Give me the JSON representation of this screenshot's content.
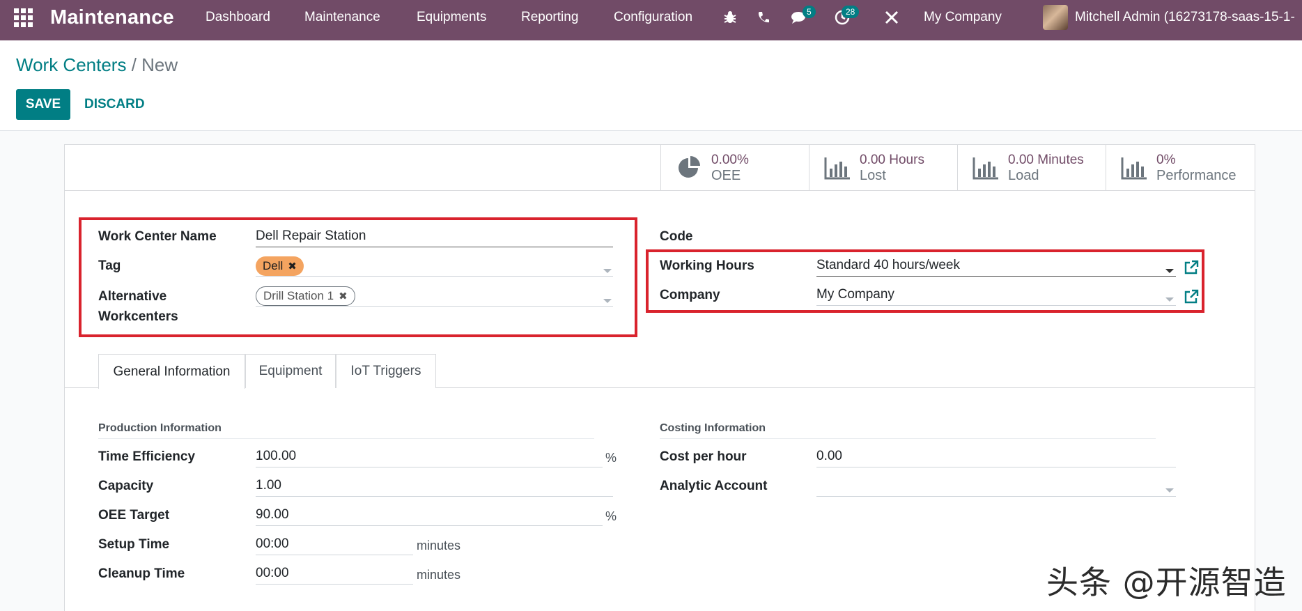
{
  "navbar": {
    "app_name": "Maintenance",
    "menu": [
      "Dashboard",
      "Maintenance",
      "Equipments",
      "Reporting",
      "Configuration"
    ],
    "messages_badge": "5",
    "activities_badge": "28",
    "company": "My Company",
    "user": "Mitchell Admin (16273178-saas-15-1-"
  },
  "breadcrumb": {
    "parent": "Work Centers",
    "separator": "/",
    "current": "New"
  },
  "buttons": {
    "save": "SAVE",
    "discard": "DISCARD"
  },
  "stats": [
    {
      "value": "0.00%",
      "label": "OEE",
      "icon": "pie-chart-icon"
    },
    {
      "value": "0.00 Hours",
      "label": "Lost",
      "icon": "bar-chart-icon"
    },
    {
      "value": "0.00 Minutes",
      "label": "Load",
      "icon": "bar-chart-icon"
    },
    {
      "value": "0%",
      "label": "Performance",
      "icon": "bar-chart-icon"
    }
  ],
  "form": {
    "work_center_name_label": "Work Center Name",
    "work_center_name_value": "Dell Repair Station",
    "tag_label": "Tag",
    "tag_value": "Dell",
    "alt_label_line1": "Alternative",
    "alt_label_line2": "Workcenters",
    "alt_value": "Drill Station 1",
    "code_label": "Code",
    "working_hours_label": "Working Hours",
    "working_hours_value": "Standard 40 hours/week",
    "company_label": "Company",
    "company_value": "My Company"
  },
  "tabs": [
    "General Information",
    "Equipment",
    "IoT Triggers"
  ],
  "production": {
    "title": "Production Information",
    "time_efficiency_label": "Time Efficiency",
    "time_efficiency_value": "100.00",
    "capacity_label": "Capacity",
    "capacity_value": "1.00",
    "oee_target_label": "OEE Target",
    "oee_target_value": "90.00",
    "setup_time_label": "Setup Time",
    "setup_time_value": "00:00",
    "cleanup_time_label": "Cleanup Time",
    "cleanup_time_value": "00:00",
    "percent_unit": "%",
    "minutes_unit": "minutes"
  },
  "costing": {
    "title": "Costing Information",
    "cost_per_hour_label": "Cost per hour",
    "cost_per_hour_value": "0.00",
    "analytic_account_label": "Analytic Account",
    "analytic_account_value": ""
  },
  "watermark": "头条 @开源智造",
  "colors": {
    "brand": "#714b67",
    "primary": "#017e84",
    "highlight": "#d9232d",
    "tag_dell": "#f4a460"
  }
}
